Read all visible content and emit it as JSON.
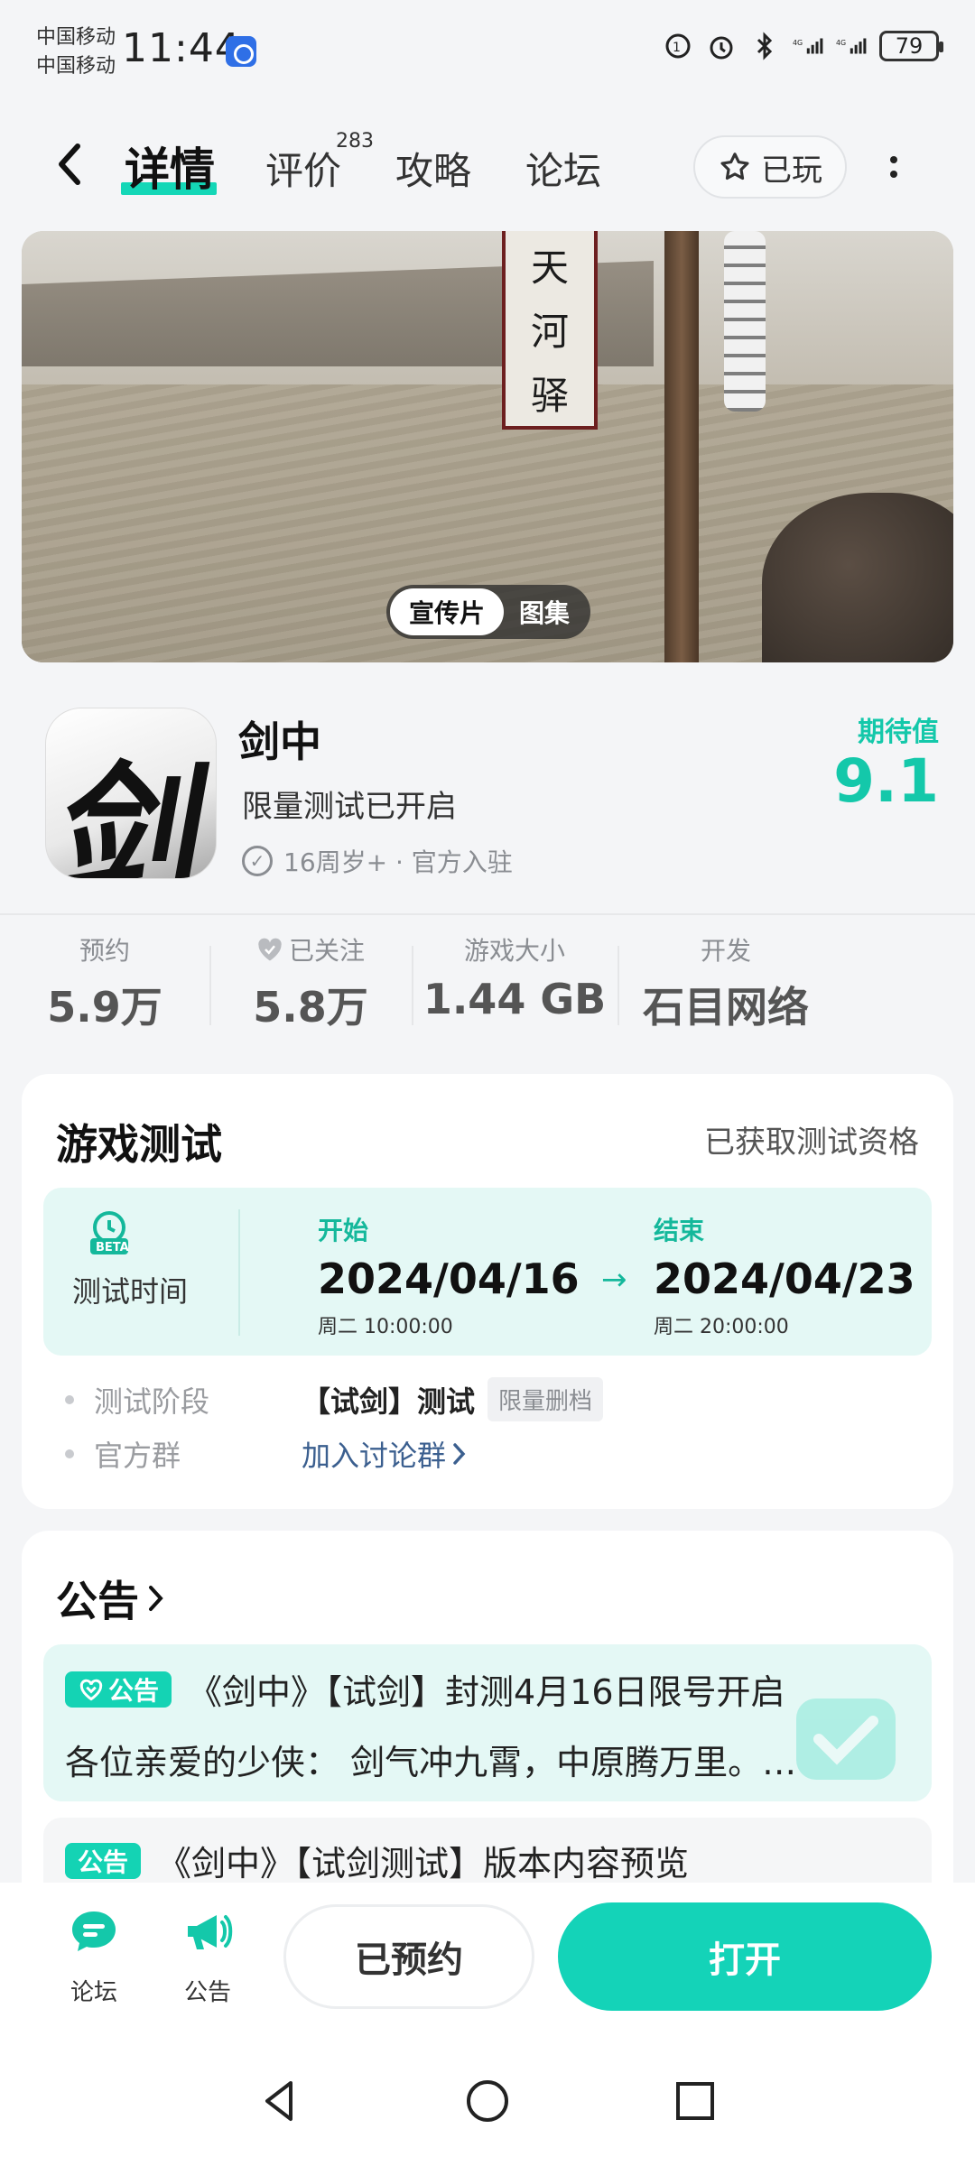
{
  "status_bar": {
    "carrier_1": "中国移动",
    "carrier_2": "中国移动",
    "time": "11:44",
    "battery": "79",
    "net_1": "4G",
    "net_2": "4G"
  },
  "nav": {
    "tabs": [
      {
        "label": "详情",
        "active": true
      },
      {
        "label": "评价",
        "count": "283"
      },
      {
        "label": "攻略"
      },
      {
        "label": "论坛"
      }
    ],
    "played_label": "已玩"
  },
  "banner": {
    "sign_chars": [
      "天",
      "河",
      "驿"
    ],
    "media_tabs": [
      {
        "label": "宣传片",
        "active": true
      },
      {
        "label": "图集"
      }
    ]
  },
  "app": {
    "icon_char": "剑",
    "name": "剑中",
    "subtitle": "限量测试已开启",
    "age_info": "16周岁+ · 官方入驻",
    "expect_label": "期待值",
    "expect_score": "9.1"
  },
  "stats": [
    {
      "label": "预约",
      "value": "5.9万"
    },
    {
      "label": "已关注",
      "value": "5.8万"
    },
    {
      "label": "游戏大小",
      "value": "1.44 GB"
    },
    {
      "label": "开发",
      "value": "石目网络"
    }
  ],
  "test": {
    "title": "游戏测试",
    "status": "已获取测试资格",
    "beta": "BETA",
    "time_label": "测试时间",
    "start_label": "开始",
    "start_date": "2024/04/16",
    "start_time": "周二  10:00:00",
    "end_label": "结束",
    "end_date": "2024/04/23",
    "end_time": "周二  20:00:00",
    "phase_label": "测试阶段",
    "phase_value": "【试剑】测试",
    "phase_tag": "限量删档",
    "group_label": "官方群",
    "group_link": "加入讨论群"
  },
  "announcements": {
    "title": "公告",
    "items": [
      {
        "badge": "公告",
        "title": "《剑中》【试剑】封测4月16日限号开启",
        "excerpt": "各位亲爱的少侠：  剑气冲九霄，中原腾万里。…"
      },
      {
        "badge": "公告",
        "title": "《剑中》【试剑测试】版本内容预览"
      }
    ]
  },
  "bottom": {
    "forum": "论坛",
    "notice": "公告",
    "reserved": "已预约",
    "open": "打开"
  }
}
